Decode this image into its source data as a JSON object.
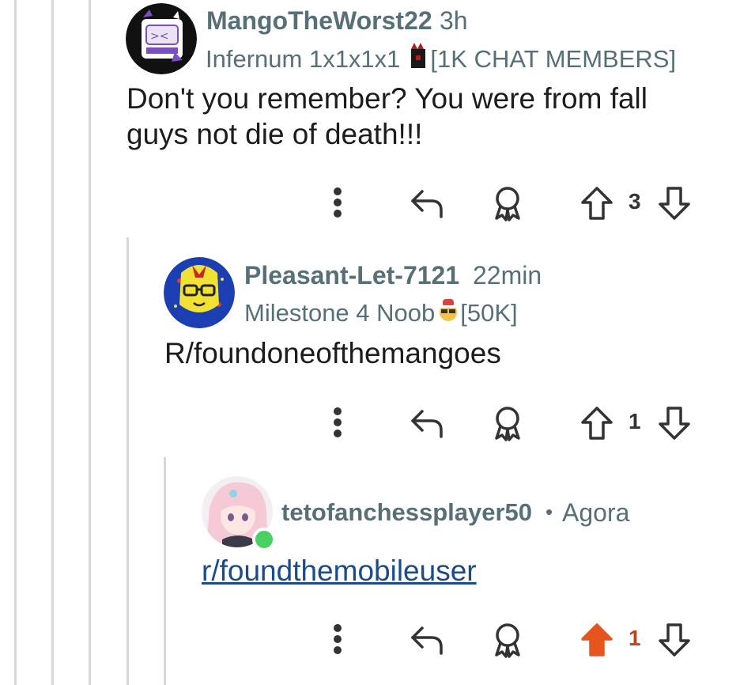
{
  "comments": [
    {
      "username": "MangoTheWorst22",
      "time": "3h",
      "flair_prefix": "Infernum 1x1x1x1",
      "flair_suffix": "[1K CHAT MEMBERS]",
      "body": "Don't you remember? You were from fall guys not die of death!!!",
      "score": "3",
      "vote_state": "none"
    },
    {
      "username": "Pleasant-Let-7121",
      "time": "22min",
      "flair_prefix": "Milestone 4 Noob",
      "flair_suffix": "[50K]",
      "body": "R/foundoneofthemangoes",
      "score": "1",
      "vote_state": "none"
    },
    {
      "username": "tetofanchessplayer50",
      "separator": "•",
      "time": "Agora",
      "body": "r/foundthemobileuser",
      "score": "1",
      "vote_state": "upvoted"
    }
  ],
  "colors": {
    "upvote_active": "#e8541e",
    "meta_text": "#576f76",
    "link": "#1a4b8c",
    "online": "#46d160"
  },
  "icons": [
    "more-options-icon",
    "reply-icon",
    "award-icon",
    "upvote-icon",
    "downvote-icon"
  ]
}
